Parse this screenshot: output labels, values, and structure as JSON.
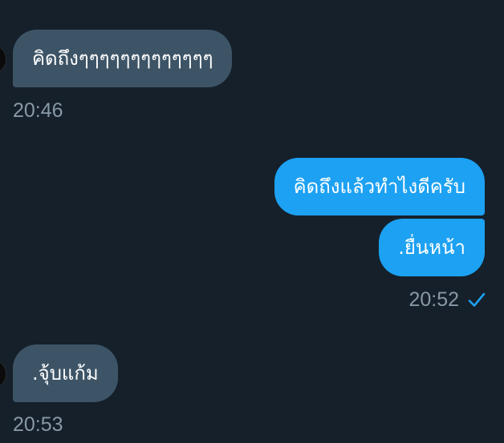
{
  "chat": {
    "messages": [
      {
        "direction": "in",
        "text": "คิดถึงๆๆๆๆๆๆๆๆๆๆๆๆๆ"
      },
      {
        "direction": "out",
        "text": "คิดถึงแล้วทำไงดีครับ"
      },
      {
        "direction": "out",
        "text": ".ยื่นหน้า"
      },
      {
        "direction": "in",
        "text": ".จุ้บแก้ม"
      }
    ],
    "timestamps": {
      "first_in": "20:46",
      "out_group": "20:52",
      "second_in": "20:53"
    },
    "read_receipt_icon": "checkmark-icon",
    "colors": {
      "background": "#15202b",
      "incoming_bubble": "#3d5466",
      "outgoing_bubble": "#1da1f2",
      "timestamp": "#8899a6",
      "checkmark": "#1da1f2"
    }
  }
}
